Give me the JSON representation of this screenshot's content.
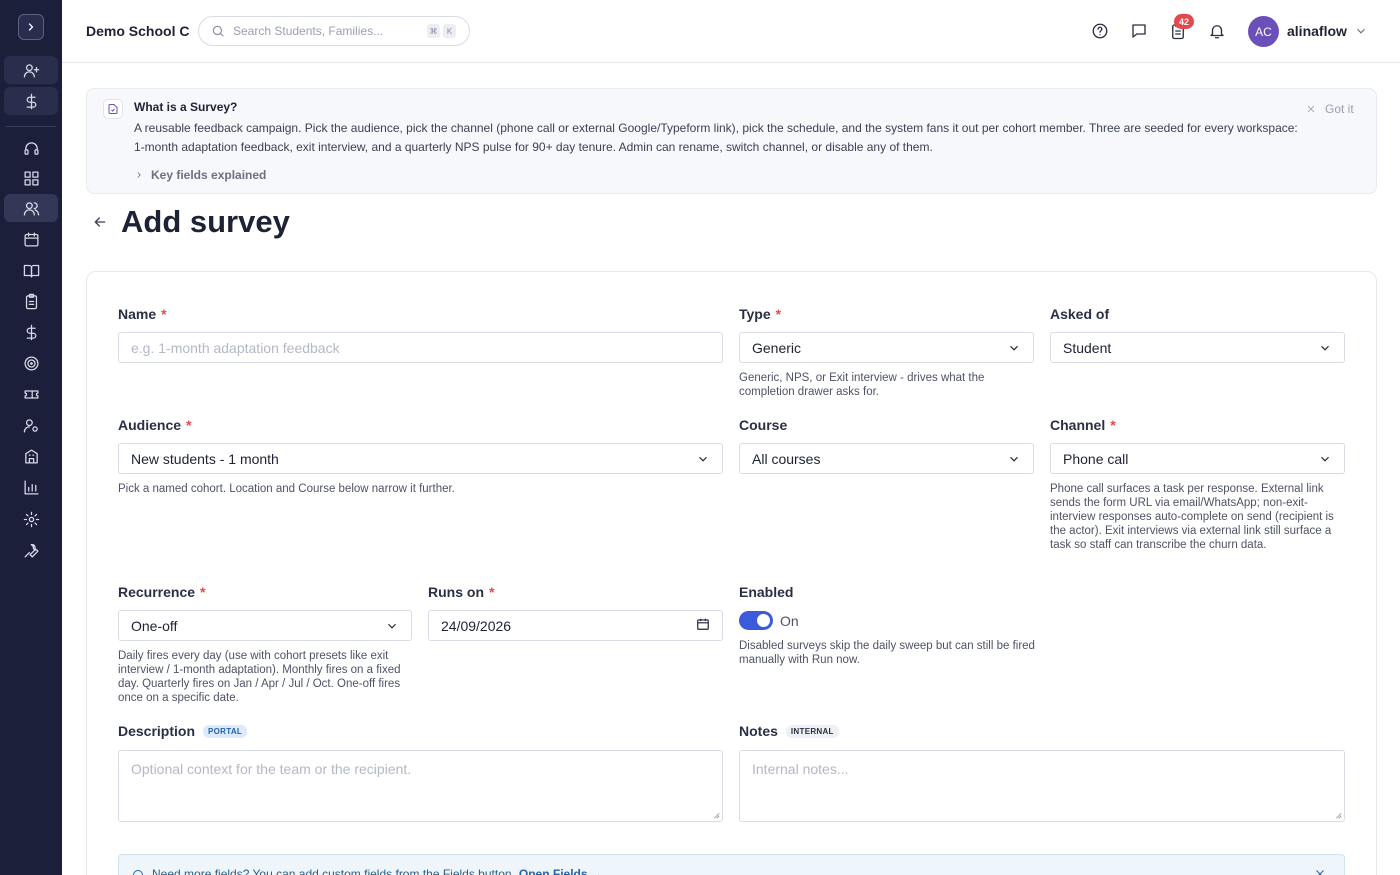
{
  "app": {
    "school_name": "Demo School C",
    "search_placeholder": "Search Students, Families...",
    "kbd_keys": [
      "⌘",
      "K"
    ],
    "notification_count": "42",
    "user": {
      "initials": "AC",
      "name": "alinaflow"
    }
  },
  "sidebar": {
    "items": [
      {
        "icon": "add-user-icon"
      },
      {
        "icon": "dollar-icon"
      },
      {
        "icon": "headset-icon"
      },
      {
        "icon": "grid-icon"
      },
      {
        "icon": "users-icon"
      },
      {
        "icon": "calendar-icon"
      },
      {
        "icon": "book-icon"
      },
      {
        "icon": "clipboard-icon"
      },
      {
        "icon": "dollar-icon"
      },
      {
        "icon": "target-icon"
      },
      {
        "icon": "ticket-icon"
      },
      {
        "icon": "user-settings-icon"
      },
      {
        "icon": "building-icon"
      },
      {
        "icon": "chart-icon"
      },
      {
        "icon": "gear-icon"
      },
      {
        "icon": "wrench-icon"
      }
    ],
    "active_index": 4
  },
  "info_banner": {
    "title": "What is a Survey?",
    "body": "A reusable feedback campaign. Pick the audience, pick the channel (phone call or external Google/Typeform link), pick the schedule, and the system fans it out per cohort member. Three are seeded for every workspace: 1-month adaptation feedback, exit interview, and a quarterly NPS pulse for 90+ day tenure. Admin can rename, switch channel, or disable any of them.",
    "dismiss_label": "Got it",
    "key_fields_label": "Key fields explained"
  },
  "page": {
    "title": "Add survey"
  },
  "form": {
    "name": {
      "label": "Name",
      "placeholder": "e.g. 1-month adaptation feedback"
    },
    "type": {
      "label": "Type",
      "value": "Generic",
      "help": "Generic, NPS, or Exit interview - drives what the completion drawer asks for."
    },
    "asked_of": {
      "label": "Asked of",
      "value": "Student"
    },
    "audience": {
      "label": "Audience",
      "value": "New students - 1 month",
      "help": "Pick a named cohort. Location and Course below narrow it further."
    },
    "course": {
      "label": "Course",
      "value": "All courses"
    },
    "channel": {
      "label": "Channel",
      "value": "Phone call",
      "help": "Phone call surfaces a task per response. External link sends the form URL via email/WhatsApp; non-exit-interview responses auto-complete on send (recipient is the actor). Exit interviews via external link still surface a task so staff can transcribe the churn data."
    },
    "recurrence": {
      "label": "Recurrence",
      "value": "One-off",
      "help": "Daily fires every day (use with cohort presets like exit interview / 1-month adaptation). Monthly fires on a fixed day. Quarterly fires on Jan / Apr / Jul / Oct. One-off fires once on a specific date."
    },
    "runs_on": {
      "label": "Runs on",
      "value": "24/09/2026"
    },
    "enabled": {
      "label": "Enabled",
      "state": "On",
      "checked": true,
      "help": "Disabled surveys skip the daily sweep but can still be fired manually with Run now."
    },
    "description": {
      "label": "Description",
      "tag": "PORTAL",
      "placeholder": "Optional context for the team or the recipient."
    },
    "notes": {
      "label": "Notes",
      "tag": "INTERNAL",
      "placeholder": "Internal notes..."
    },
    "required_marker": "*"
  },
  "notice": {
    "text": "Need more fields? You can add custom fields from the Fields button.",
    "link": "Open Fields →"
  },
  "colors": {
    "sidebar_bg": "#1c1f3a",
    "accent": "#3b5bdb",
    "required": "#e5484d",
    "avatar": "#6b4fbb"
  }
}
